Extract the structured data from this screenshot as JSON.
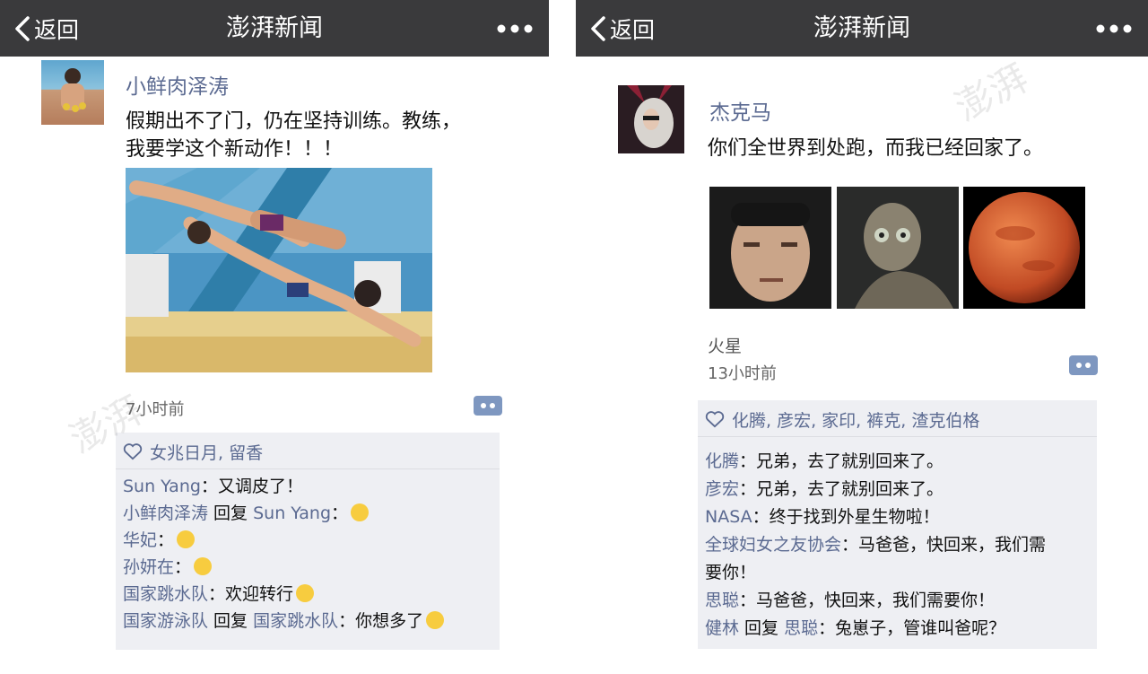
{
  "left": {
    "nav": {
      "back_label": "返回",
      "title": "澎湃新闻"
    },
    "post": {
      "username": "小鲜肉泽涛",
      "text_line1": "假期出不了门，仍在坚持训练。教练，",
      "text_line2": "我要学这个新动作！！！",
      "time": "7小时前",
      "likes": "女兆日月, 留香",
      "comments": [
        {
          "name": "Sun Yang",
          "sep": "：",
          "text": "又调皮了！"
        },
        {
          "name": "小鲜肉泽涛",
          "reply": " 回复 ",
          "to": "Sun Yang",
          "sep": "：",
          "text": ""
        },
        {
          "name": "华妃",
          "sep": "：",
          "text": ""
        },
        {
          "name": "孙妍在",
          "sep": "：",
          "text": ""
        },
        {
          "name": "国家跳水队",
          "sep": "：",
          "text": "欢迎转行"
        },
        {
          "name": "国家游泳队",
          "reply": " 回复 ",
          "to": "国家跳水队",
          "sep": "：",
          "text": "你想多了"
        }
      ]
    }
  },
  "right": {
    "nav": {
      "back_label": "返回",
      "title": "澎湃新闻"
    },
    "post": {
      "username": "杰克马",
      "text": "你们全世界到处跑，而我已经回家了。",
      "location": "火星",
      "time": "13小时前",
      "likes": "化腾, 彦宏, 家印, 裤克, 渣克伯格",
      "comments": [
        {
          "name": "化腾",
          "sep": "：",
          "text": "兄弟，去了就别回来了。"
        },
        {
          "name": "彦宏",
          "sep": "：",
          "text": "兄弟，去了就别回来了。"
        },
        {
          "name": "NASA",
          "sep": "：",
          "text": "终于找到外星生物啦！"
        },
        {
          "name": "全球妇女之友协会",
          "sep": "：",
          "text": "马爸爸，快回来，我们需"
        },
        {
          "text": "要你！"
        },
        {
          "name": "思聪",
          "sep": "：",
          "text": "马爸爸，快回来，我们需要你！"
        },
        {
          "name": "健林",
          "reply": " 回复 ",
          "to": "思聪",
          "sep": "：",
          "text": "兔崽子，管谁叫爸呢？"
        }
      ]
    }
  }
}
